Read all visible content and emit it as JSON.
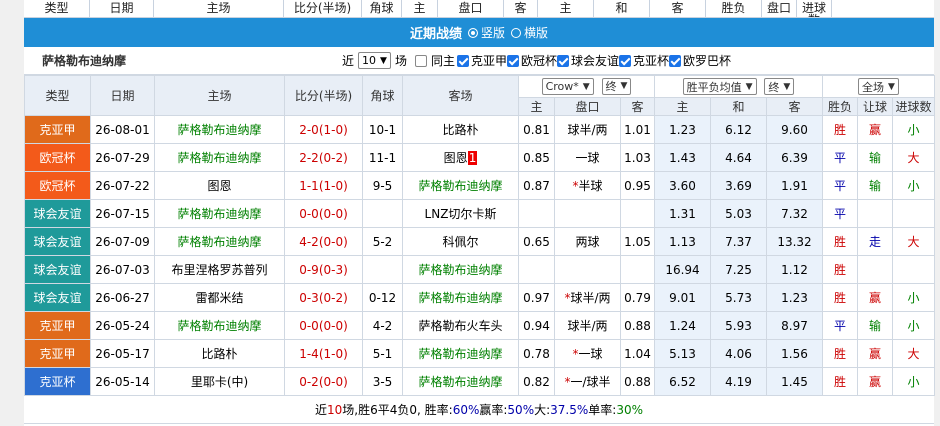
{
  "top_row": [
    "类型",
    "日期",
    "主场",
    "比分(半场)",
    "角球",
    "主",
    "盘口",
    "客",
    "主",
    "和",
    "客",
    "胜负",
    "盘口",
    "进球数"
  ],
  "banner": {
    "title": "近期战绩",
    "opt1": "竖版",
    "opt2": "横版"
  },
  "filter": {
    "team": "萨格勒布迪纳摩",
    "near_label": "近",
    "count": "10",
    "count_unit": "场",
    "same_home": "同主",
    "checks": [
      "克亚甲",
      "欧冠杯",
      "球会友谊",
      "克亚杯",
      "欧罗巴杯"
    ]
  },
  "header": {
    "type": "类型",
    "date": "日期",
    "home": "主场",
    "score": "比分(半场)",
    "corner": "角球",
    "away": "客场",
    "company1": "Crow*",
    "end1": "终",
    "odds_sel": "胜平负均值",
    "end2": "终",
    "all": "全场",
    "hc_home": "主",
    "hc_line": "盘口",
    "hc_away": "客",
    "eu_home": "主",
    "eu_draw": "和",
    "eu_away": "客",
    "res_wl": "胜负",
    "res_hc": "让球",
    "res_goals": "进球数"
  },
  "rows": [
    {
      "type": "克亚甲",
      "color": "c-orange",
      "date": "26-08-01",
      "home": "萨格勒布迪纳摩",
      "hg": true,
      "score": "2-0",
      "half": "(1-0)",
      "corner": "10-1",
      "away": "比路朴",
      "ag": false,
      "h1": "0.81",
      "line": "球半/两",
      "h2": "1.01",
      "e1": "1.23",
      "e2": "6.12",
      "e3": "9.60",
      "wl": "胜",
      "hc": "赢",
      "goals": "小"
    },
    {
      "type": "欧冠杯",
      "color": "c-red",
      "date": "26-07-29",
      "home": "萨格勒布迪纳摩",
      "hg": true,
      "score": "2-2",
      "half": "(0-2)",
      "corner": "11-1",
      "away": "图恩",
      "badge": "1",
      "ag": false,
      "h1": "0.85",
      "line": "一球",
      "h2": "1.03",
      "e1": "1.43",
      "e2": "4.64",
      "e3": "6.39",
      "wl": "平",
      "hc": "输",
      "goals": "大"
    },
    {
      "type": "欧冠杯",
      "color": "c-red",
      "date": "26-07-22",
      "home": "图恩",
      "hg": false,
      "score": "1-1",
      "half": "(1-0)",
      "corner": "9-5",
      "away": "萨格勒布迪纳摩",
      "ag": true,
      "h1": "0.87",
      "star": "*",
      "line": "半球",
      "h2": "0.95",
      "e1": "3.60",
      "e2": "3.69",
      "e3": "1.91",
      "wl": "平",
      "hc": "输",
      "goals": "小"
    },
    {
      "type": "球会友谊",
      "color": "c-teal",
      "date": "26-07-15",
      "home": "萨格勒布迪纳摩",
      "hg": true,
      "score": "0-0",
      "half": "(0-0)",
      "corner": "",
      "away": "LNZ切尔卡斯",
      "ag": false,
      "h1": "",
      "line": "",
      "h2": "",
      "e1": "1.31",
      "e2": "5.03",
      "e3": "7.32",
      "wl": "平",
      "hc": "",
      "goals": ""
    },
    {
      "type": "球会友谊",
      "color": "c-teal",
      "date": "26-07-09",
      "home": "萨格勒布迪纳摩",
      "hg": true,
      "score": "4-2",
      "half": "(0-0)",
      "corner": "5-2",
      "away": "科佩尔",
      "ag": false,
      "h1": "0.65",
      "line": "两球",
      "h2": "1.05",
      "e1": "1.13",
      "e2": "7.37",
      "e3": "13.32",
      "wl": "胜",
      "hc": "走",
      "goals": "大"
    },
    {
      "type": "球会友谊",
      "color": "c-teal",
      "date": "26-07-03",
      "home": "布里涅格罗苏普列",
      "hg": false,
      "score": "0-9",
      "half": "(0-3)",
      "corner": "",
      "away": "萨格勒布迪纳摩",
      "ag": true,
      "h1": "",
      "line": "",
      "h2": "",
      "e1": "16.94",
      "e2": "7.25",
      "e3": "1.12",
      "wl": "胜",
      "hc": "",
      "goals": ""
    },
    {
      "type": "球会友谊",
      "color": "c-teal",
      "date": "26-06-27",
      "home": "雷都米结",
      "hg": false,
      "score": "0-3",
      "half": "(0-2)",
      "corner": "0-12",
      "away": "萨格勒布迪纳摩",
      "ag": true,
      "h1": "0.97",
      "star": "*",
      "line": "球半/两",
      "h2": "0.79",
      "e1": "9.01",
      "e2": "5.73",
      "e3": "1.23",
      "wl": "胜",
      "hc": "赢",
      "goals": "小"
    },
    {
      "type": "克亚甲",
      "color": "c-orange",
      "date": "26-05-24",
      "home": "萨格勒布迪纳摩",
      "hg": true,
      "score": "0-0",
      "half": "(0-0)",
      "corner": "4-2",
      "away": "萨格勒布火车头",
      "ag": false,
      "h1": "0.94",
      "line": "球半/两",
      "h2": "0.88",
      "e1": "1.24",
      "e2": "5.93",
      "e3": "8.97",
      "wl": "平",
      "hc": "输",
      "goals": "小"
    },
    {
      "type": "克亚甲",
      "color": "c-orange",
      "date": "26-05-17",
      "home": "比路朴",
      "hg": false,
      "score": "1-4",
      "half": "(1-0)",
      "corner": "5-1",
      "away": "萨格勒布迪纳摩",
      "ag": true,
      "h1": "0.78",
      "star": "*",
      "line": "一球",
      "h2": "1.04",
      "e1": "5.13",
      "e2": "4.06",
      "e3": "1.56",
      "wl": "胜",
      "hc": "赢",
      "goals": "大"
    },
    {
      "type": "克亚杯",
      "color": "c-blue",
      "date": "26-05-14",
      "home": "里耶卡(中)",
      "hg": false,
      "score": "0-2",
      "half": "(0-0)",
      "corner": "3-5",
      "away": "萨格勒布迪纳摩",
      "ag": true,
      "h1": "0.82",
      "star": "*",
      "line": "一/球半",
      "h2": "0.88",
      "e1": "6.52",
      "e2": "4.19",
      "e3": "1.45",
      "wl": "胜",
      "hc": "赢",
      "goals": "小"
    }
  ],
  "footer": {
    "p1": "近",
    "n": "10",
    "p2": "场,胜6平4负0, 胜率:",
    "win": "60%",
    "p3": " 赢率:",
    "hcwin": "50%",
    "p4": " 大:",
    "big": "37.5%",
    "p5": " 单率:",
    "odd": "30%"
  }
}
